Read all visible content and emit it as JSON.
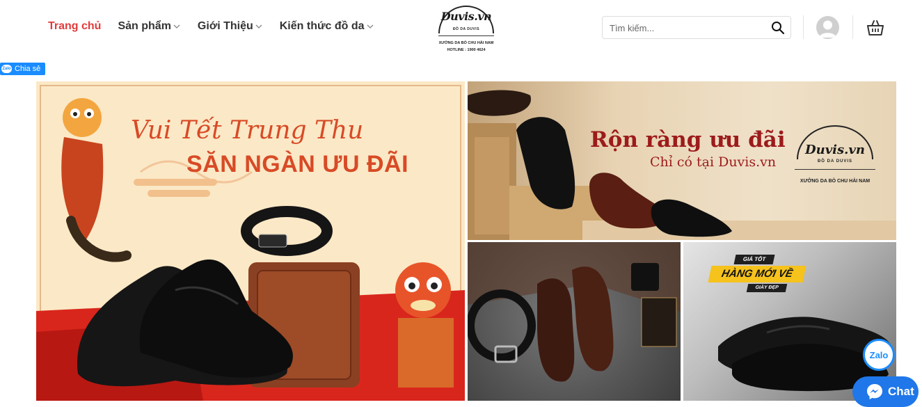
{
  "nav": {
    "items": [
      {
        "label": "Trang chủ",
        "active": true,
        "has_dropdown": false
      },
      {
        "label": "Sản phẩm",
        "active": false,
        "has_dropdown": true
      },
      {
        "label": "Giới Thiệu",
        "active": false,
        "has_dropdown": true
      },
      {
        "label": "Kiến thức đồ da",
        "active": false,
        "has_dropdown": true
      }
    ]
  },
  "logo": {
    "brand": "Duvis.vn",
    "subtitle": "ĐỒ DA DUVIS",
    "workshop": "XƯỞNG DA BÒ CHU HẢI NAM",
    "hotline": "HOTLINE : 1900 4624"
  },
  "search": {
    "placeholder": "Tìm kiếm...",
    "icon": "search-icon"
  },
  "share": {
    "label": "Chia sẻ",
    "badge": "Zalo"
  },
  "banners": {
    "main": {
      "line1": "Vui Tết Trung Thu",
      "line2": "SĂN NGÀN ƯU ĐÃI"
    },
    "top": {
      "line1": "Rộn ràng ưu đãi",
      "line2": "Chỉ có tại Duvis.vn",
      "logo_brand": "Duvis.vn",
      "logo_sub": "ĐỒ DA DUVIS",
      "logo_workshop": "XƯỞNG DA BÒ CHU HẢI NAM"
    },
    "bottom_right": {
      "tag1": "GIÁ TỐT",
      "tag2": "HÀNG MỚI VỀ",
      "tag3": "GIÀY ĐẸP"
    }
  },
  "floating": {
    "zalo_label": "Zalo",
    "chat_label": "Chat"
  },
  "colors": {
    "accent": "#e23a3a",
    "zalo_blue": "#1a8cff",
    "messenger_blue": "#1f77e9",
    "badge_yellow": "#f6c21c"
  }
}
